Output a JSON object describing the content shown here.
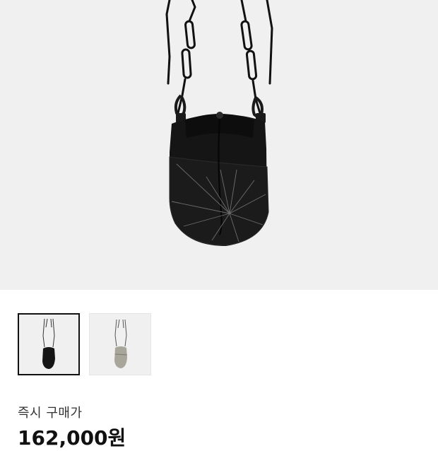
{
  "product": {
    "price_label": "즉시 구매가",
    "price": "162,000원"
  },
  "thumbnails": [
    {
      "name": "black",
      "color": "#151515"
    },
    {
      "name": "gray",
      "color": "#a8a69a"
    }
  ],
  "colors": {
    "hero_bg": "#f0f0f0",
    "bag_main": "#151515",
    "stitch": "#6e6e6e",
    "selected_border": "#111111"
  }
}
